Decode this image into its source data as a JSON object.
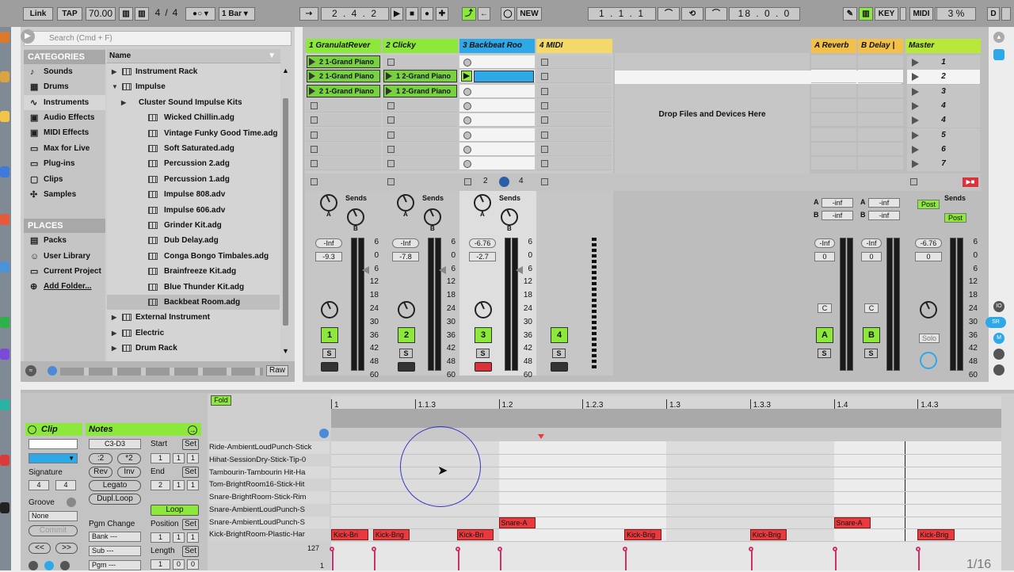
{
  "transport": {
    "link": "Link",
    "tap": "TAP",
    "tempo": "70.00",
    "signature_num": "4",
    "signature_den": "4",
    "quantize": "1 Bar",
    "position": "2 . 4 . 2",
    "new": "NEW",
    "loop_start": "1 . 1 . 1",
    "loop_length": "18 . 0 . 0",
    "key": "KEY",
    "midi": "MIDI",
    "cpu": "3 %",
    "d": "D"
  },
  "browser": {
    "search_placeholder": "Search (Cmd + F)",
    "categories_header": "CATEGORIES",
    "name_header": "Name",
    "categories": [
      "Sounds",
      "Drums",
      "Instruments",
      "Audio Effects",
      "MIDI Effects",
      "Max for Live",
      "Plug-ins",
      "Clips",
      "Samples"
    ],
    "places_header": "PLACES",
    "places": [
      "Packs",
      "User Library",
      "Current Project",
      "Add Folder..."
    ],
    "files": [
      "Instrument Rack",
      "Impulse",
      "Cluster Sound Impulse Kits",
      "Wicked Chillin.adg",
      "Vintage Funky Good Time.adg",
      "Soft Saturated.adg",
      "Percussion 2.adg",
      "Percussion 1.adg",
      "Impulse 808.adv",
      "Impulse 606.adv",
      "Grinder Kit.adg",
      "Dub Delay.adg",
      "Conga Bongo Timbales.adg",
      "Brainfreeze Kit.adg",
      "Blue Thunder Kit.adg",
      "Backbeat Room.adg",
      "External Instrument",
      "Electric",
      "Drum Rack"
    ],
    "raw": "Raw"
  },
  "session": {
    "tracks": [
      "1 GranulatRever",
      "2 Clicky",
      "3 Backbeat Roo",
      "4 MIDI"
    ],
    "returns": [
      "A Reverb",
      "B Delay |"
    ],
    "master": "Master",
    "clip_label": "2 1-Grand Piano",
    "clip_label2": "1 2-Grand Piano",
    "drop_text": "Drop Files and Devices Here",
    "scenes": [
      "1",
      "2",
      "3",
      "4",
      "4",
      "5",
      "6",
      "7"
    ],
    "sends": "Sends",
    "post": "Post",
    "inf": "-inf",
    "vol_inf": "-Inf",
    "vol1": "-9.3",
    "vol2": "-7.8",
    "vol3_top": "-6.76",
    "vol3": "-2.7",
    "master_top": "-6.76",
    "zero": "0",
    "c": "C",
    "ch_nums": [
      "1",
      "2",
      "3",
      "4"
    ],
    "ret_letters": [
      "A",
      "B"
    ],
    "s": "S",
    "solo": "Solo",
    "io_num1": "2",
    "io_num2": "4",
    "scale": [
      "6",
      "0",
      "6",
      "12",
      "18",
      "24",
      "30",
      "36",
      "42",
      "48",
      "60"
    ]
  },
  "detail": {
    "fold": "Fold",
    "clip_title": "Clip",
    "notes_title": "Notes",
    "signature": "Signature",
    "sig_num": "4",
    "sig_den": "4",
    "groove": "Groove",
    "groove_val": "None",
    "commit": "Commit",
    "note_range": "C3-D3",
    "div2": ":2",
    "mul2": "*2",
    "rev": "Rev",
    "inv": "Inv",
    "legato": "Legato",
    "dupl": "Dupl.Loop",
    "pgm_change": "Pgm Change",
    "bank": "Bank ---",
    "sub": "Sub ---",
    "pgm": "Pgm ---",
    "start": "Start",
    "end": "End",
    "set": "Set",
    "loop": "Loop",
    "position": "Position",
    "length": "Length",
    "one": "1",
    "two": "2",
    "zero": "0",
    "ruler": [
      "1",
      "1.1.3",
      "1.2",
      "1.2.3",
      "1.3",
      "1.3.3",
      "1.4",
      "1.4.3"
    ],
    "keys": [
      "Ride-AmbientLoudPunch-Stick",
      "Hihat-SessionDry-Stick-Tip-0",
      "Tambourin-Tambourin Hit-Ha",
      "Tom-BrightRoom16-Stick-Hit",
      "Snare-BrightRoom-Stick-Rim",
      "Snare-AmbientLoudPunch-S",
      "Snare-AmbientLoudPunch-S",
      "Kick-BrightRoom-Plastic-Har"
    ],
    "notes": [
      {
        "label": "Kick-Bri",
        "row": 7,
        "start": 0.0,
        "len": 0.055
      },
      {
        "label": "Kick-Brig",
        "row": 7,
        "start": 0.0625,
        "len": 0.055
      },
      {
        "label": "Kick-Bri",
        "row": 7,
        "start": 0.1875,
        "len": 0.055
      },
      {
        "label": "Snare-A",
        "row": 6,
        "start": 0.25,
        "len": 0.055
      },
      {
        "label": "Kick-Brig",
        "row": 7,
        "start": 0.4375,
        "len": 0.055
      },
      {
        "label": "Kick-Brig",
        "row": 7,
        "start": 0.625,
        "len": 0.055
      },
      {
        "label": "Snare-A",
        "row": 6,
        "start": 0.75,
        "len": 0.055
      },
      {
        "label": "Kick-Brig",
        "row": 7,
        "start": 0.875,
        "len": 0.055
      }
    ],
    "vel_max": "127",
    "vel_min": "1",
    "grid": "1/16"
  }
}
